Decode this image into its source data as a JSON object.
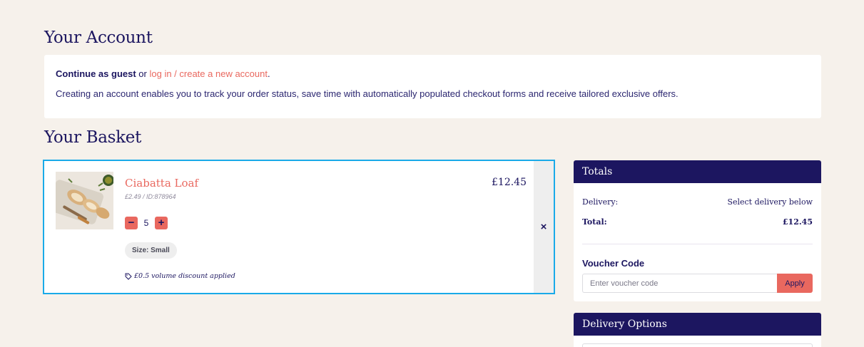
{
  "account": {
    "title": "Your Account",
    "guest_label": "Continue as guest",
    "or_text": " or ",
    "login_link": "log in / create a new account",
    "period": ".",
    "info_text": "Creating an account enables you to track your order status, save time with automatically populated checkout forms and receive tailored exclusive offers."
  },
  "basket": {
    "title": "Your Basket",
    "items": [
      {
        "name": "Ciabatta Loaf",
        "meta": "£2.49 /  ID:878964",
        "price": "£12.45",
        "quantity": "5",
        "minus_icon": "−",
        "plus_icon": "+",
        "size": "Size: Small",
        "discount": "£0.5 volume discount applied",
        "remove_icon": "×"
      }
    ]
  },
  "totals": {
    "title": "Totals",
    "delivery_label": "Delivery:",
    "delivery_value": "Select delivery below",
    "total_label": "Total:",
    "total_value": "£12.45",
    "voucher_label": "Voucher Code",
    "voucher_placeholder": "Enter voucher code",
    "apply_label": "Apply"
  },
  "delivery": {
    "title": "Delivery Options"
  },
  "colors": {
    "navy": "#1c1660",
    "coral": "#e9685f",
    "focus_blue": "#1aaae8",
    "background": "#f6f1eb"
  },
  "icons": {
    "tag": "tag-icon",
    "close": "close-icon",
    "minus": "minus-icon",
    "plus": "plus-icon"
  }
}
